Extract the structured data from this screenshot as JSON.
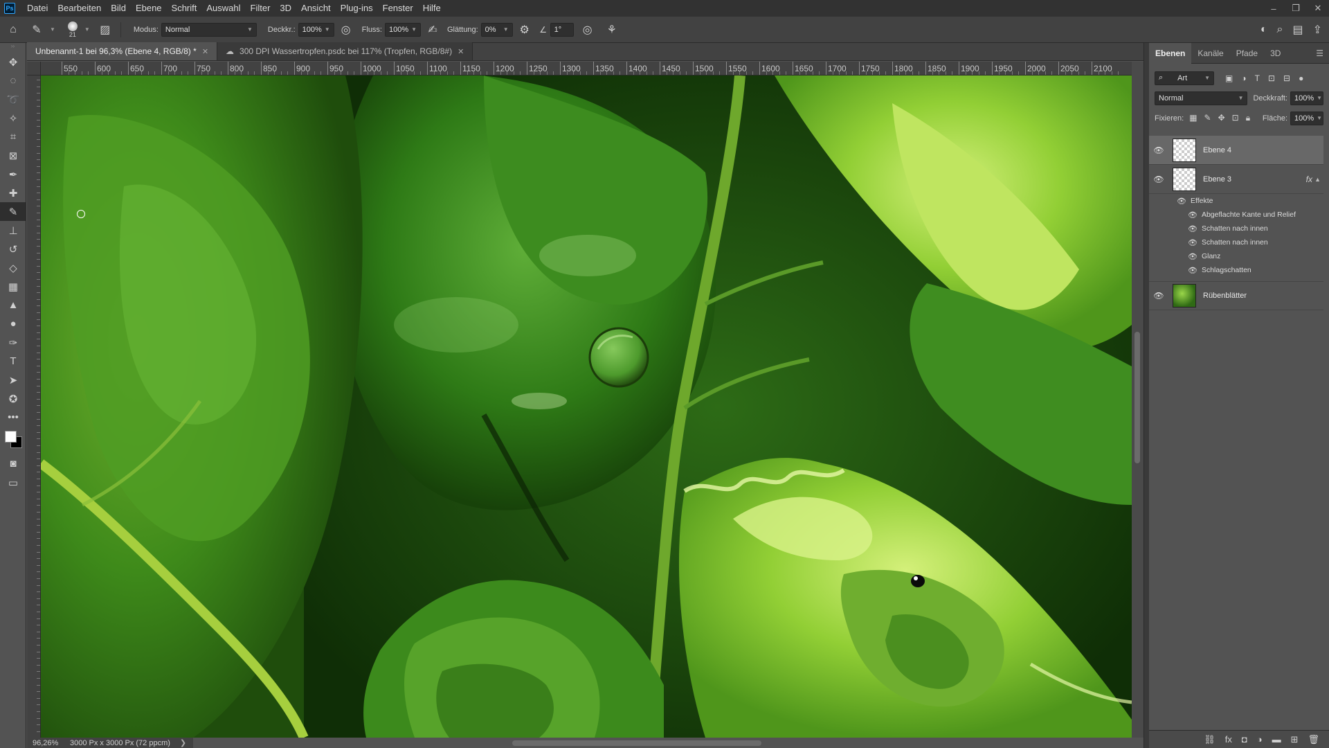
{
  "menubar": {
    "logo": "Ps",
    "items": [
      "Datei",
      "Bearbeiten",
      "Bild",
      "Ebene",
      "Schrift",
      "Auswahl",
      "Filter",
      "3D",
      "Ansicht",
      "Plug-ins",
      "Fenster",
      "Hilfe"
    ],
    "window_controls": [
      "–",
      "❐",
      "✕"
    ]
  },
  "options": {
    "brush_size": "21",
    "mode_label": "Modus:",
    "mode_value": "Normal",
    "opacity_label": "Deckkr.:",
    "opacity_value": "100%",
    "flow_label": "Fluss:",
    "flow_value": "100%",
    "smoothing_label": "Glättung:",
    "smoothing_value": "0%",
    "angle_value": "1°"
  },
  "tabs": [
    {
      "title": "Unbenannt-1 bei 96,3% (Ebene 4, RGB/8) *"
    },
    {
      "title": "300 DPI Wassertropfen.psdc bei 117% (Tropfen, RGB/8#)"
    }
  ],
  "ruler": {
    "h_labels": [
      "550",
      "600",
      "650",
      "700",
      "750",
      "800",
      "850",
      "900",
      "950",
      "1000",
      "1050",
      "1100",
      "1150",
      "1200",
      "1250",
      "1300",
      "1350",
      "1400",
      "1450",
      "1500",
      "1550",
      "1600",
      "1650",
      "1700",
      "1750",
      "1800",
      "1850",
      "1900",
      "1950",
      "2000",
      "2050",
      "2100"
    ]
  },
  "status": {
    "zoom": "96,26%",
    "doc_size": "3000 Px x 3000 Px (72 ppcm)",
    "arrow": "❯"
  },
  "colors": {
    "foreground": "#ffffff",
    "background": "#000000"
  },
  "layers_panel": {
    "tabs": [
      "Ebenen",
      "Kanäle",
      "Pfade",
      "3D"
    ],
    "filter_kind": "Art",
    "blend_mode": "Normal",
    "opacity_label": "Deckkraft:",
    "opacity_value": "100%",
    "lock_label": "Fixieren:",
    "fill_label": "Fläche:",
    "fill_value": "100%",
    "layers": [
      {
        "name": "Ebene 4",
        "selected": true,
        "thumb": "checker"
      },
      {
        "name": "Ebene 3",
        "selected": false,
        "thumb": "checker",
        "fx": "fx"
      },
      {
        "name": "Rübenblätter",
        "selected": false,
        "thumb": "photo"
      }
    ],
    "effects_header": "Effekte",
    "effects": [
      "Abgeflachte Kante und Relief",
      "Schatten nach innen",
      "Schatten nach innen",
      "Glanz",
      "Schlagschatten"
    ]
  }
}
